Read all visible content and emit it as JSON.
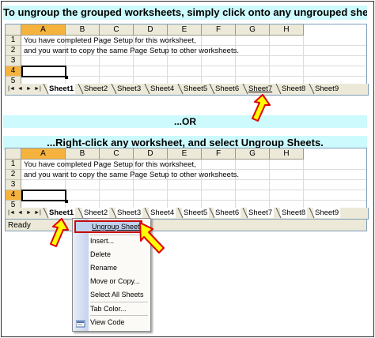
{
  "banner_top": "To ungroup the grouped worksheets, simply click onto any ungrouped sheet...",
  "banner_or": "...OR",
  "banner_mid": "...Right-click any worksheet, and select Ungroup Sheets.",
  "columns": [
    "A",
    "B",
    "C",
    "D",
    "E",
    "F",
    "G",
    "H"
  ],
  "rows": [
    "1",
    "2",
    "3",
    "4",
    "5"
  ],
  "cell_line1": "You have completed Page Setup for this worksheet,",
  "cell_line2": "and you want to copy the same Page Setup to other worksheets.",
  "sheet_tabs": [
    "Sheet1",
    "Sheet2",
    "Sheet3",
    "Sheet4",
    "Sheet5",
    "Sheet6",
    "Sheet7",
    "Sheet8",
    "Sheet9"
  ],
  "status_text": "Ready",
  "context_menu": {
    "items": [
      "Ungroup Sheets",
      "Insert...",
      "Delete",
      "Rename",
      "Move or Copy...",
      "Select All Sheets",
      "Tab Color...",
      "View Code"
    ]
  },
  "colors": {
    "banner_bg": "#ccfafd",
    "arrow_fill": "#ffff00",
    "arrow_outline": "#e00000",
    "selected_header": "#f5b33e"
  }
}
